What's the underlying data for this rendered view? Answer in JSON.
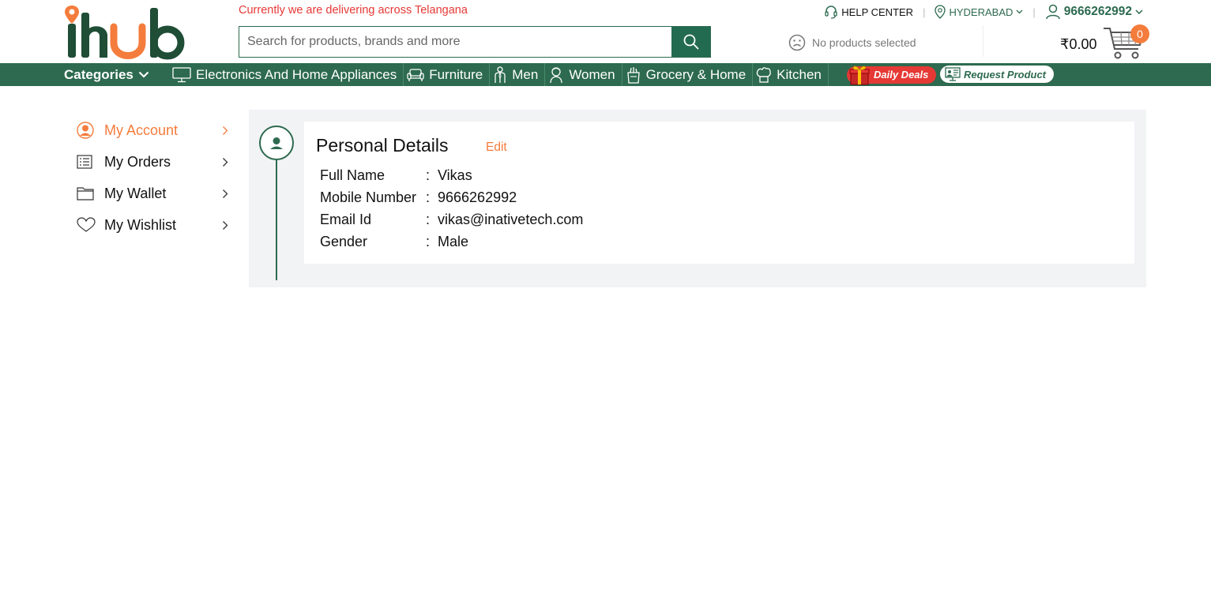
{
  "brand": {
    "logo_text": "ihub",
    "primary_color": "#2d6a4f",
    "accent_color": "#f47c3c",
    "alert_color": "#e53935"
  },
  "header": {
    "delivery_notice": "Currently we are delivering across Telangana",
    "search": {
      "placeholder": "Search for products, brands and more",
      "value": ""
    },
    "help_center": "HELP CENTER",
    "city": "HYDERABAD",
    "user_phone": "9666262992",
    "no_products": "No products selected",
    "cart_amount": "₹0.00",
    "cart_count": "0"
  },
  "nav": {
    "categories_label": "Categories",
    "items": [
      {
        "label": "Electronics And Home Appliances",
        "icon": "monitor-icon"
      },
      {
        "label": "Furniture",
        "icon": "sofa-icon"
      },
      {
        "label": "Men",
        "icon": "man-icon"
      },
      {
        "label": "Women",
        "icon": "woman-icon"
      },
      {
        "label": "Grocery & Home",
        "icon": "grocery-bag-icon"
      },
      {
        "label": "Kitchen",
        "icon": "chef-hat-icon"
      }
    ],
    "daily_deals": "Daily Deals",
    "request_product": "Request Product"
  },
  "sidebar": {
    "items": [
      {
        "label": "My Account",
        "icon": "user-circle-icon",
        "active": true
      },
      {
        "label": "My Orders",
        "icon": "list-icon",
        "active": false
      },
      {
        "label": "My Wallet",
        "icon": "folder-icon",
        "active": false
      },
      {
        "label": "My Wishlist",
        "icon": "heart-icon",
        "active": false
      }
    ]
  },
  "personal": {
    "title": "Personal Details",
    "edit_label": "Edit",
    "fields": [
      {
        "key": "Full Name",
        "value": "Vikas"
      },
      {
        "key": "Mobile Number",
        "value": "9666262992"
      },
      {
        "key": "Email Id",
        "value": "vikas@inativetech.com"
      },
      {
        "key": "Gender",
        "value": "Male"
      }
    ]
  }
}
